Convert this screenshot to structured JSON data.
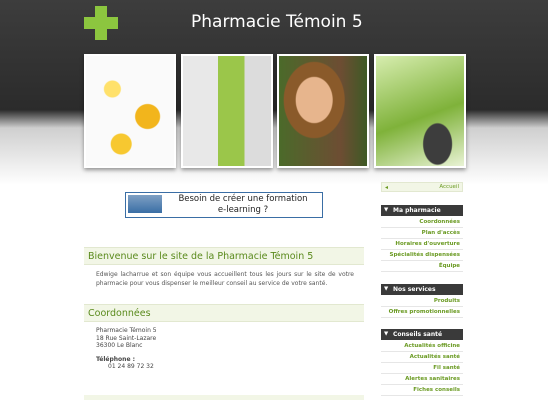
{
  "header": {
    "title": "Pharmacie Témoin 5",
    "accent_color": "#8cc63f"
  },
  "banner": {
    "line1": "Besoin de créer une formation",
    "line2": "e-learning ?"
  },
  "main": {
    "welcome_title": "Bienvenue sur le site de la Pharmacie Témoin 5",
    "welcome_text": "Edwige lacharrue et son équipe vous accueillent tous les jours sur le site de votre pharmacie pour vous dispenser le meilleur conseil au service de votre santé.",
    "coords_title": "Coordonnées",
    "address": [
      "Pharmacie Témoin 5",
      "18 Rue Saint-Lazare",
      "36300 Le Blanc"
    ],
    "phone_label": "Téléphone :",
    "phone": "01 24 89 72 32"
  },
  "sidebar": {
    "home": "Accueil",
    "sections": [
      {
        "title": "Ma pharmacie",
        "items": [
          "Coordonnées",
          "Plan d'accès",
          "Horaires d'ouverture",
          "Spécialités dispensées",
          "Équipe"
        ]
      },
      {
        "title": "Nos services",
        "items": [
          "Produits",
          "Offres promotionnelles"
        ]
      },
      {
        "title": "Conseils santé",
        "items": [
          "Actualités officine",
          "Actualités santé",
          "Fil santé",
          "Alertes sanitaires",
          "Fiches conseils"
        ]
      }
    ]
  }
}
